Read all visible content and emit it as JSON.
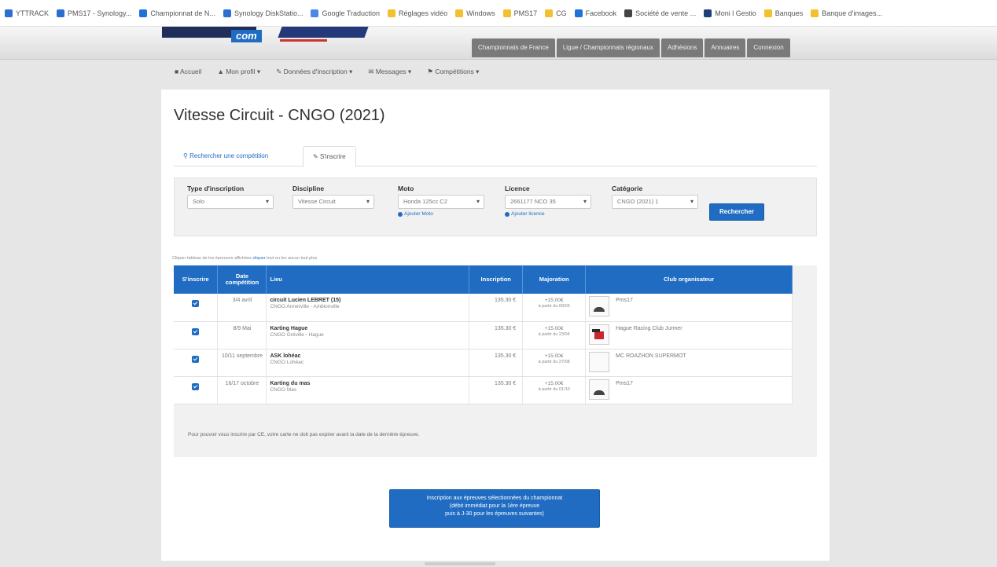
{
  "bookmarks": [
    {
      "label": "YTTRACK",
      "color": "#2d6fd0"
    },
    {
      "label": "PMS17 - Synology...",
      "color": "#2d6fd0"
    },
    {
      "label": "Championnat de N...",
      "color": "#1f73d8"
    },
    {
      "label": "Synology DiskStatio...",
      "color": "#2d6fd0"
    },
    {
      "label": "Google Traduction",
      "color": "#4c86e8"
    },
    {
      "label": "Réglages vidéo",
      "color": "#f2c12e"
    },
    {
      "label": "Windows",
      "color": "#f2c12e"
    },
    {
      "label": "PMS17",
      "color": "#f2c12e"
    },
    {
      "label": "CG",
      "color": "#f2c12e"
    },
    {
      "label": "Facebook",
      "color": "#1f73d8"
    },
    {
      "label": "Société de vente ...",
      "color": "#444444"
    },
    {
      "label": "Moni l Gestio",
      "color": "#1f3f7a"
    },
    {
      "label": "Banques",
      "color": "#f2c12e"
    },
    {
      "label": "Banque d'images...",
      "color": "#f2c12e"
    }
  ],
  "header": {
    "logo_text": "com",
    "logo_tagline": "",
    "topnav": [
      "Championnats de France",
      "Ligue / Championnats régionaux",
      "Adhésions",
      "Annuaires",
      "Connexion"
    ]
  },
  "subnav": [
    "Accueil",
    "Mon profil",
    "Données d'inscription",
    "Messages",
    "Compétitions"
  ],
  "page": {
    "title": "Vitesse Circuit - CNGO (2021)",
    "tabs": [
      "Rechercher une compétition",
      "S'inscrire"
    ]
  },
  "filters": [
    {
      "label": "Type d'inscription",
      "value": "Solo",
      "add": ""
    },
    {
      "label": "Discipline",
      "value": "Vitesse Circuit",
      "add": ""
    },
    {
      "label": "Moto",
      "value": "Honda 125cc C2",
      "add": "Ajouter Moto"
    },
    {
      "label": "Licence",
      "value": "2661177 NCO 35",
      "add": "Ajouter licence"
    },
    {
      "label": "Catégorie",
      "value": "CNGO (2021) 1",
      "add": ""
    }
  ],
  "search_button": "Rechercher",
  "note": {
    "text": "Cliquer tableau de les épreuves affichées ",
    "link": "cliquer",
    "tail": " tout ou les aucun tout plus"
  },
  "table": {
    "headers": [
      "S'inscrire",
      "Date compétition",
      "Lieu",
      "Inscription",
      "Majoration",
      "Club organisateur"
    ],
    "rows": [
      {
        "date": "3/4 avril",
        "lieu": "circuit Lucien LEBRET (15)",
        "lieu2": "CNGO Annerville - Ambionville",
        "inscription": "135.30 €",
        "maj": "+15.00€",
        "maj2": "à partir du 09/03",
        "club": "Pms17",
        "thumb": "helmet"
      },
      {
        "date": "8/9 Mai",
        "lieu": "Karting Hague",
        "lieu2": "CNGO Gréville - Hague",
        "inscription": "135.30 €",
        "maj": "+15.00€",
        "maj2": "à partir du 23/04",
        "club": "Hague Racing Club Jurmer",
        "thumb": "flag"
      },
      {
        "date": "10/11 septembre",
        "lieu": "ASK lohéac",
        "lieu2": "CNGO Lohéac",
        "inscription": "135.30 €",
        "maj": "+15.00€",
        "maj2": "à partir du 27/08",
        "club": "MC ROAZHON SUPERMOT",
        "thumb": "blank"
      },
      {
        "date": "16/17 octobre",
        "lieu": "Karting du mas",
        "lieu2": "CNGO Mas",
        "inscription": "135.30 €",
        "maj": "+15.00€",
        "maj2": "à partir du 01/10",
        "club": "Pms17",
        "thumb": "helmet"
      }
    ]
  },
  "footer_note": "Pour pouvoir vous inscrire par CE, votre carte ne doit pas expirer avant la date de la dernière épreuve.",
  "submit": {
    "line1": "Inscription aux épreuves sélectionnées du championnat",
    "line2": "(débit immédiat pour la 1ère épreuve",
    "line3": "puis à J-30 pour les épreuves suivantes)"
  }
}
